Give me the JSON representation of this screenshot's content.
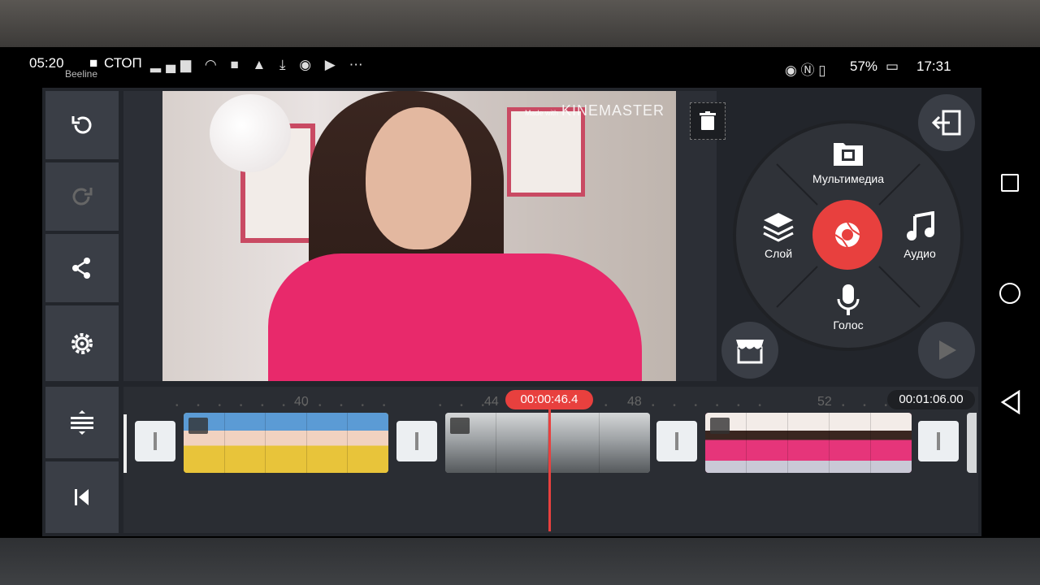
{
  "status_bar": {
    "time_left": "05:20",
    "carrier": "Beeline",
    "stop_label": "СТОП",
    "battery": "57%",
    "time_right": "17:31"
  },
  "left_toolbar": {
    "buttons": [
      {
        "name": "undo-button",
        "icon": "undo-icon"
      },
      {
        "name": "redo-button",
        "icon": "redo-icon"
      },
      {
        "name": "share-button",
        "icon": "share-icon"
      },
      {
        "name": "settings-button",
        "icon": "gear-icon"
      }
    ],
    "lower": [
      {
        "name": "timeline-height-button",
        "icon": "expand-vertical-icon"
      },
      {
        "name": "skip-to-start-button",
        "icon": "skip-start-icon"
      }
    ]
  },
  "preview": {
    "watermark_small": "Made with",
    "watermark": "KINEMASTER"
  },
  "media_wheel": {
    "media_label": "Мультимедиа",
    "layer_label": "Слой",
    "audio_label": "Аудио",
    "voice_label": "Голос"
  },
  "timeline": {
    "ruler": [
      "40",
      "44",
      "48",
      "52"
    ],
    "current_time": "00:00:46.4",
    "total_time": "00:01:06.00",
    "clips": [
      {
        "name": "clip-yellow",
        "color": "#e8c43a"
      },
      {
        "name": "clip-gray",
        "color": "#8b8f92"
      },
      {
        "name": "clip-pink",
        "color": "#e6357a"
      }
    ]
  },
  "colors": {
    "accent": "#e8403e",
    "panel": "#3a3e46",
    "background": "#22252b"
  }
}
